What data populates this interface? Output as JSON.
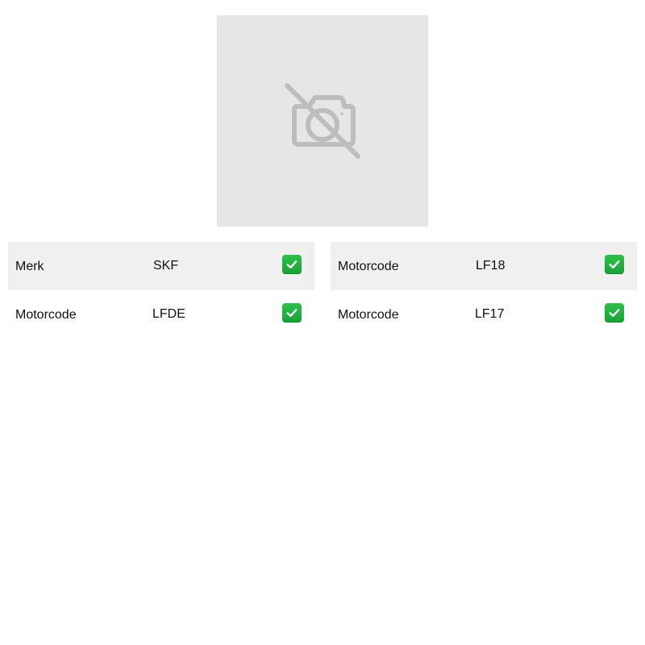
{
  "image": {
    "state": "no-image",
    "icon": "camera-off-icon",
    "colors": {
      "background": "#e6e6e6",
      "icon": "#bdbdbd"
    }
  },
  "specs": {
    "left": [
      {
        "label": "Merk",
        "value": "SKF",
        "status_icon": "check-icon"
      },
      {
        "label": "Motorcode",
        "value": "LFDE",
        "status_icon": "check-icon"
      }
    ],
    "right": [
      {
        "label": "Motorcode",
        "value": "LF18",
        "status_icon": "check-icon"
      },
      {
        "label": "Motorcode",
        "value": "LF17",
        "status_icon": "check-icon"
      }
    ]
  },
  "colors": {
    "row_shade": "#f0f0f0",
    "check_green": "#22b23f",
    "text": "#111111"
  }
}
